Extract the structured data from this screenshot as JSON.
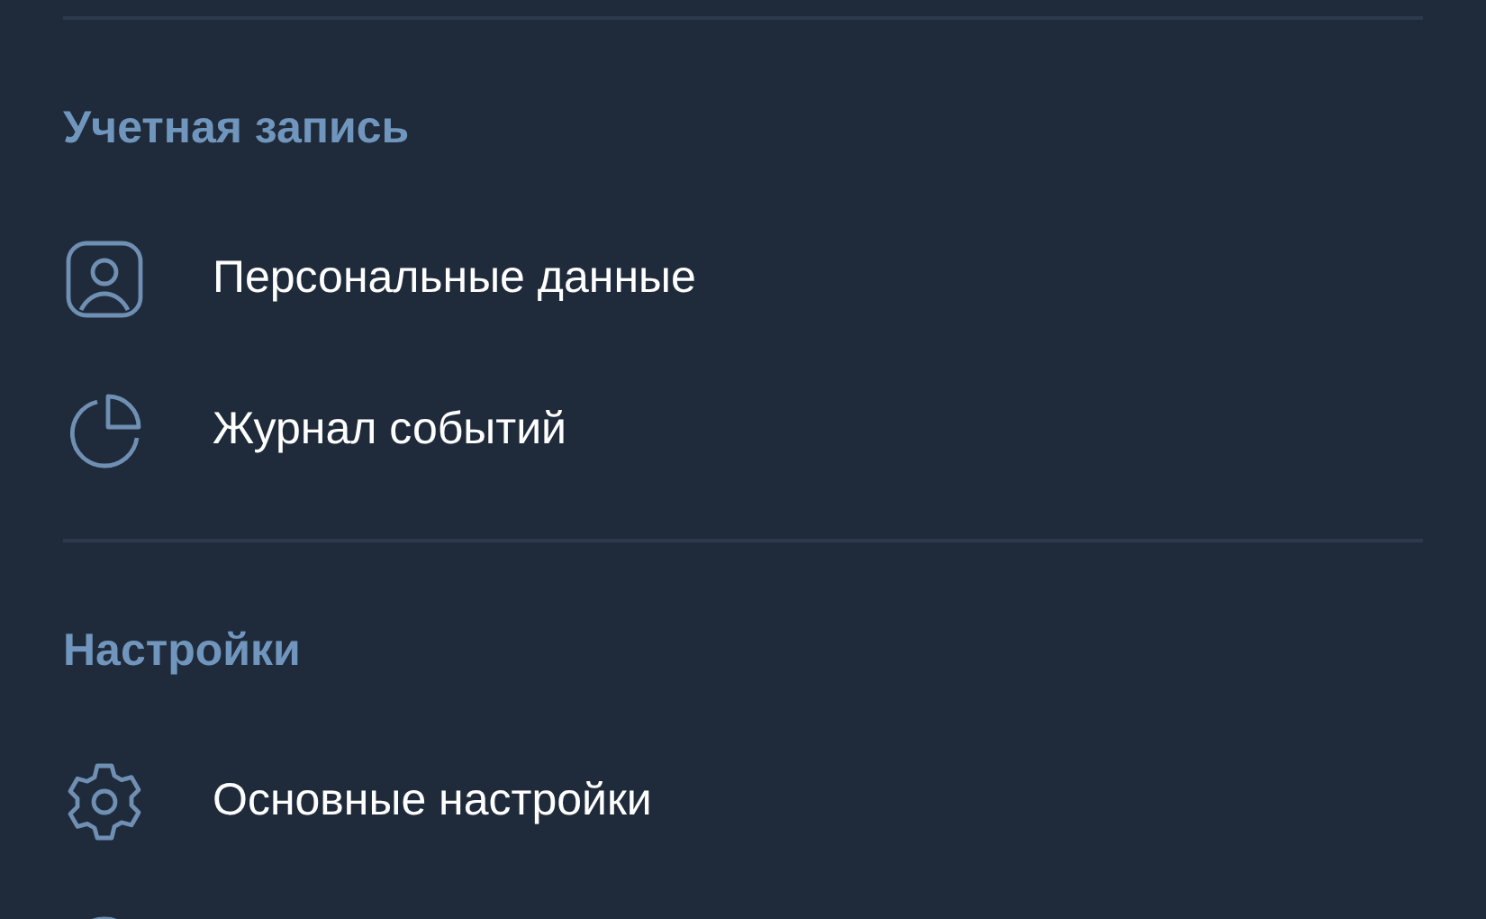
{
  "sections": [
    {
      "title": "Учетная запись",
      "items": [
        {
          "kind": "person",
          "label": "Персональные данные"
        },
        {
          "kind": "chart",
          "label": "Журнал событий"
        }
      ]
    },
    {
      "title": "Настройки",
      "items": [
        {
          "kind": "gear",
          "label": "Основные настройки"
        },
        {
          "kind": "circle"
        }
      ]
    }
  ]
}
